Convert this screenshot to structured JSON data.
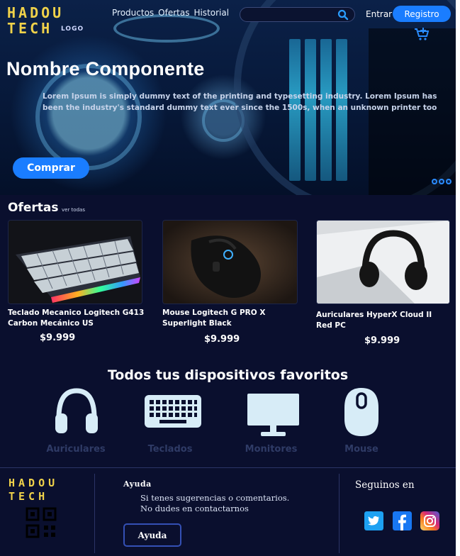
{
  "brand": {
    "line1": "HADOU",
    "line2": "TECH",
    "mini": "LOGO"
  },
  "nav": {
    "items": [
      "Productos",
      "Ofertas",
      "Historial"
    ]
  },
  "search": {
    "placeholder": ""
  },
  "auth": {
    "login": "Entrar",
    "register": "Registro"
  },
  "hero": {
    "title": "Nombre Componente",
    "description": "Lorem Ipsum is simply dummy text of the printing and typesetting industry. Lorem Ipsum has been the industry's standard dummy text ever since the 1500s, when an unknown printer too",
    "cta": "Comprar",
    "slides": 3
  },
  "ofertas": {
    "title": "Ofertas",
    "see_all": "ver todas",
    "products": [
      {
        "name": "Teclado Mecanico Logitech G413 Carbon Mecánico US",
        "price": "$9.999"
      },
      {
        "name": "Mouse Logitech G PRO X Superlight Black",
        "price": "$9.999"
      },
      {
        "name": "Auriculares HyperX Cloud II Red PC",
        "price": "$9.999"
      }
    ]
  },
  "categories": {
    "title": "Todos tus dispositivos favoritos",
    "items": [
      {
        "label": "Auriculares",
        "icon": "headphones-icon"
      },
      {
        "label": "Teclados",
        "icon": "keyboard-icon"
      },
      {
        "label": "Monitores",
        "icon": "monitor-icon"
      },
      {
        "label": "Mouse",
        "icon": "mouse-icon"
      }
    ]
  },
  "footer": {
    "help_title": "Ayuda",
    "help_text": "Si tenes sugerencias o comentarios. No dudes en contactarnos",
    "help_button": "Ayuda",
    "follow": "Seguinos en",
    "social": [
      "twitter-icon",
      "facebook-icon",
      "instagram-icon"
    ]
  },
  "colors": {
    "background": "#0a0f2e",
    "accent": "#1a7dff",
    "brand": "#f0d24a",
    "category_icon": "#d7ecf7"
  }
}
